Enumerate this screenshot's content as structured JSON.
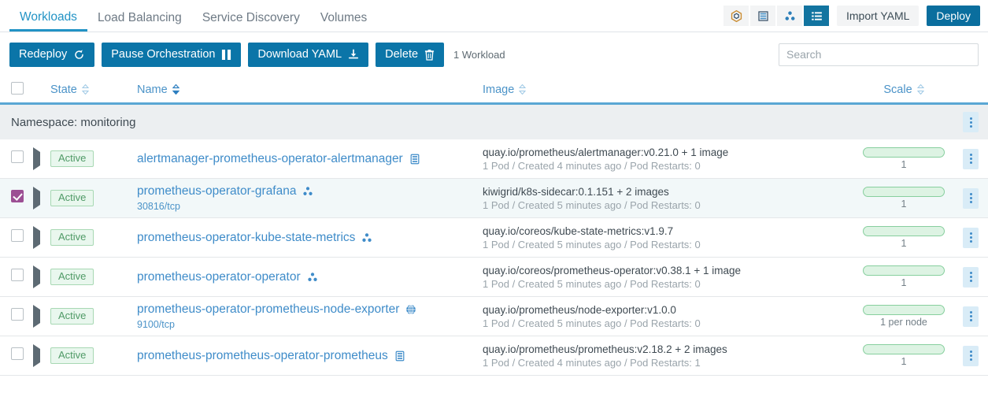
{
  "nav": {
    "tabs": [
      {
        "label": "Workloads",
        "active": true
      },
      {
        "label": "Load Balancing",
        "active": false
      },
      {
        "label": "Service Discovery",
        "active": false
      },
      {
        "label": "Volumes",
        "active": false
      }
    ],
    "view_modes": [
      {
        "icon": "cube-icon",
        "active": false
      },
      {
        "icon": "server-stack-icon",
        "active": false
      },
      {
        "icon": "cluster-nodes-icon",
        "active": false
      },
      {
        "icon": "list-view-icon",
        "active": true
      }
    ],
    "import_yaml_label": "Import YAML",
    "deploy_label": "Deploy"
  },
  "toolbar": {
    "actions": [
      {
        "label": "Redeploy",
        "icon": "redeploy-icon"
      },
      {
        "label": "Pause Orchestration",
        "icon": "pause-icon"
      },
      {
        "label": "Download YAML",
        "icon": "download-icon"
      },
      {
        "label": "Delete",
        "icon": "trash-icon"
      }
    ],
    "count_label": "1 Workload",
    "search_placeholder": "Search",
    "search_value": ""
  },
  "table": {
    "headers": {
      "state": "State",
      "name": "Name",
      "image": "Image",
      "scale": "Scale"
    },
    "group_label": "Namespace: monitoring",
    "rows": [
      {
        "selected": false,
        "state": "Active",
        "name": "alertmanager-prometheus-operator-alertmanager",
        "name_icon": "stateful-set-icon",
        "ports": "",
        "image": "quay.io/prometheus/alertmanager:v0.21.0 + 1 image",
        "image_sub": "1 Pod / Created 4 minutes ago / Pod Restarts: 0",
        "scale": "1"
      },
      {
        "selected": true,
        "state": "Active",
        "name": "prometheus-operator-grafana",
        "name_icon": "cluster-nodes-icon",
        "ports": "30816/tcp",
        "image": "kiwigrid/k8s-sidecar:0.1.151 + 2 images",
        "image_sub": "1 Pod / Created 5 minutes ago / Pod Restarts: 0",
        "scale": "1"
      },
      {
        "selected": false,
        "state": "Active",
        "name": "prometheus-operator-kube-state-metrics",
        "name_icon": "cluster-nodes-icon",
        "ports": "",
        "image": "quay.io/coreos/kube-state-metrics:v1.9.7",
        "image_sub": "1 Pod / Created 5 minutes ago / Pod Restarts: 0",
        "scale": "1"
      },
      {
        "selected": false,
        "state": "Active",
        "name": "prometheus-operator-operator",
        "name_icon": "cluster-nodes-icon",
        "ports": "",
        "image": "quay.io/coreos/prometheus-operator:v0.38.1 + 1 image",
        "image_sub": "1 Pod / Created 5 minutes ago / Pod Restarts: 0",
        "scale": "1"
      },
      {
        "selected": false,
        "state": "Active",
        "name": "prometheus-operator-prometheus-node-exporter",
        "name_icon": "globe-icon",
        "ports": "9100/tcp",
        "image": "quay.io/prometheus/node-exporter:v1.0.0",
        "image_sub": "1 Pod / Created 5 minutes ago / Pod Restarts: 0",
        "scale": "1 per node"
      },
      {
        "selected": false,
        "state": "Active",
        "name": "prometheus-prometheus-operator-prometheus",
        "name_icon": "stateful-set-icon",
        "ports": "",
        "image": "quay.io/prometheus/prometheus:v2.18.2 + 2 images",
        "image_sub": "1 Pod / Created 4 minutes ago / Pod Restarts: 1",
        "scale": "1"
      }
    ]
  },
  "colors": {
    "accent": "#2293c5",
    "primary_button": "#0a6e9e",
    "action_button": "#0b75a8",
    "link": "#3f8cc9",
    "selected_checkbox": "#9c4f94",
    "badge_text": "#4f9a66",
    "badge_border": "#a7d8b3",
    "scale_bar": "#ddf3e3"
  }
}
